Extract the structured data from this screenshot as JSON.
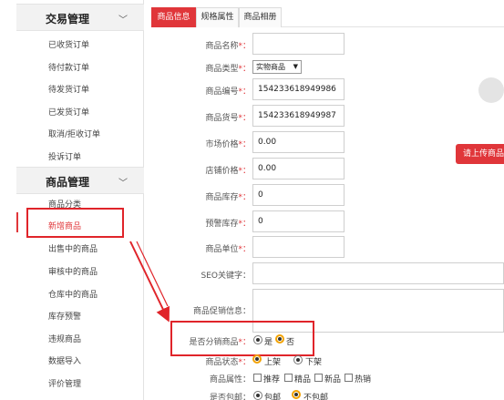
{
  "sidebar": {
    "sections": [
      {
        "title": "交易管理",
        "chevron": "﹀",
        "items": [
          "已收货订单",
          "待付款订单",
          "待发货订单",
          "已发货订单",
          "取消/拒收订单",
          "投诉订单"
        ]
      },
      {
        "title": "商品管理",
        "chevron": "﹀",
        "items": [
          "商品分类",
          "新增商品",
          "出售中的商品",
          "审核中的商品",
          "仓库中的商品",
          "库存预警",
          "违规商品",
          "数据导入",
          "评价管理"
        ]
      }
    ],
    "active_item": "新增商品"
  },
  "tabs": [
    {
      "label": "商品信息",
      "active": true
    },
    {
      "label": "规格属性",
      "active": false
    },
    {
      "label": "商品相册",
      "active": false
    }
  ],
  "form": {
    "name": {
      "label": "商品名称",
      "req": "*：",
      "value": ""
    },
    "type": {
      "label": "商品类型",
      "req": "*：",
      "value": "实物商品"
    },
    "code": {
      "label": "商品编号",
      "req": "*：",
      "value": "154233618949986"
    },
    "sku": {
      "label": "商品货号",
      "req": "*：",
      "value": "154233618949987"
    },
    "market_price": {
      "label": "市场价格",
      "req": "*：",
      "value": "0.00"
    },
    "shop_price": {
      "label": "店铺价格",
      "req": "*：",
      "value": "0.00"
    },
    "stock": {
      "label": "商品库存",
      "req": "*：",
      "value": "0"
    },
    "warn_stock": {
      "label": "预警库存",
      "req": "*：",
      "value": "0"
    },
    "unit": {
      "label": "商品单位",
      "req": "*：",
      "value": ""
    },
    "seo": {
      "label": "SEO关键字：",
      "value": ""
    },
    "promo": {
      "label": "商品促销信息：",
      "value": ""
    },
    "distribution": {
      "label": "是否分销商品",
      "req": "*：",
      "yes": "是",
      "no": "否",
      "selected": "否"
    },
    "status": {
      "label": "商品状态",
      "req": "*：",
      "on": "上架",
      "off": "下架",
      "selected": "上架"
    },
    "attrs": {
      "label": "商品属性：",
      "options": [
        "推荐",
        "精品",
        "新品",
        "热销"
      ]
    },
    "shipping": {
      "label": "是否包邮：",
      "yes": "包邮",
      "no": "不包邮",
      "selected": "不包邮"
    }
  },
  "upload_button": "请上传商品图片",
  "colors": {
    "accent": "#e0363a",
    "annotation": "#e0242a",
    "radio_highlight": "#f3a200"
  }
}
